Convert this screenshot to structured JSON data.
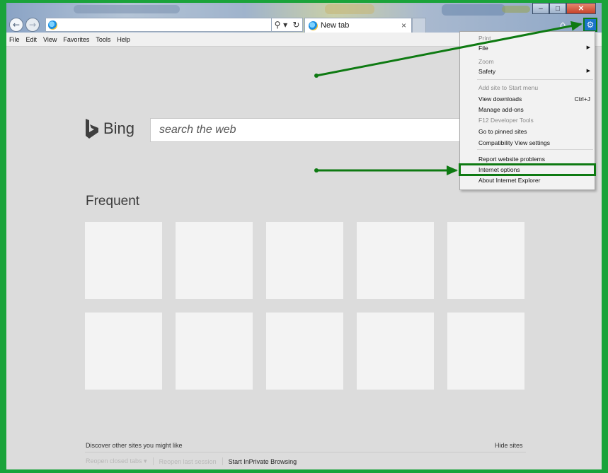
{
  "browser": {
    "tab_title": "New tab",
    "tab_close": "×",
    "address_tools": {
      "search": "⚲ ▾",
      "refresh": "↻"
    },
    "home": "⌂",
    "gear": "⚙",
    "back": "←",
    "forward": "→",
    "window_controls": {
      "minimize": "–",
      "maximize": "□",
      "close": "✕"
    }
  },
  "menubar": [
    "File",
    "Edit",
    "View",
    "Favorites",
    "Tools",
    "Help"
  ],
  "tools_menu": {
    "items": [
      {
        "label": "Print",
        "disabled": true
      },
      {
        "label": "File",
        "submenu": true
      },
      {
        "label": "Zoom",
        "disabled": true
      },
      {
        "label": "Safety",
        "submenu": true
      },
      {
        "label": "Add site to Start menu",
        "disabled": true
      },
      {
        "label": "View downloads",
        "shortcut": "Ctrl+J"
      },
      {
        "label": "Manage add-ons"
      },
      {
        "label": "F12 Developer Tools",
        "disabled": true
      },
      {
        "label": "Go to pinned sites"
      },
      {
        "label": "Compatibility View settings"
      },
      {
        "label": "Report website problems"
      },
      {
        "label": "Internet options",
        "highlighted": true
      },
      {
        "label": "About Internet Explorer"
      }
    ],
    "submenu_arrow": "▶"
  },
  "page": {
    "bing_label": "Bing",
    "search_placeholder": "search the web",
    "frequent_title": "Frequent",
    "discover_text": "Discover other sites you might like",
    "hide_sites": "Hide sites",
    "reopen_closed_tabs": "Reopen closed tabs ▾",
    "reopen_last_session": "Reopen last session",
    "start_inprivate": "Start InPrivate Browsing"
  },
  "colors": {
    "annotation_green": "#0e7a12",
    "frame_border": "#1aa33a",
    "page_bg": "#dcdcdc",
    "tile_bg": "#f3f3f3"
  }
}
